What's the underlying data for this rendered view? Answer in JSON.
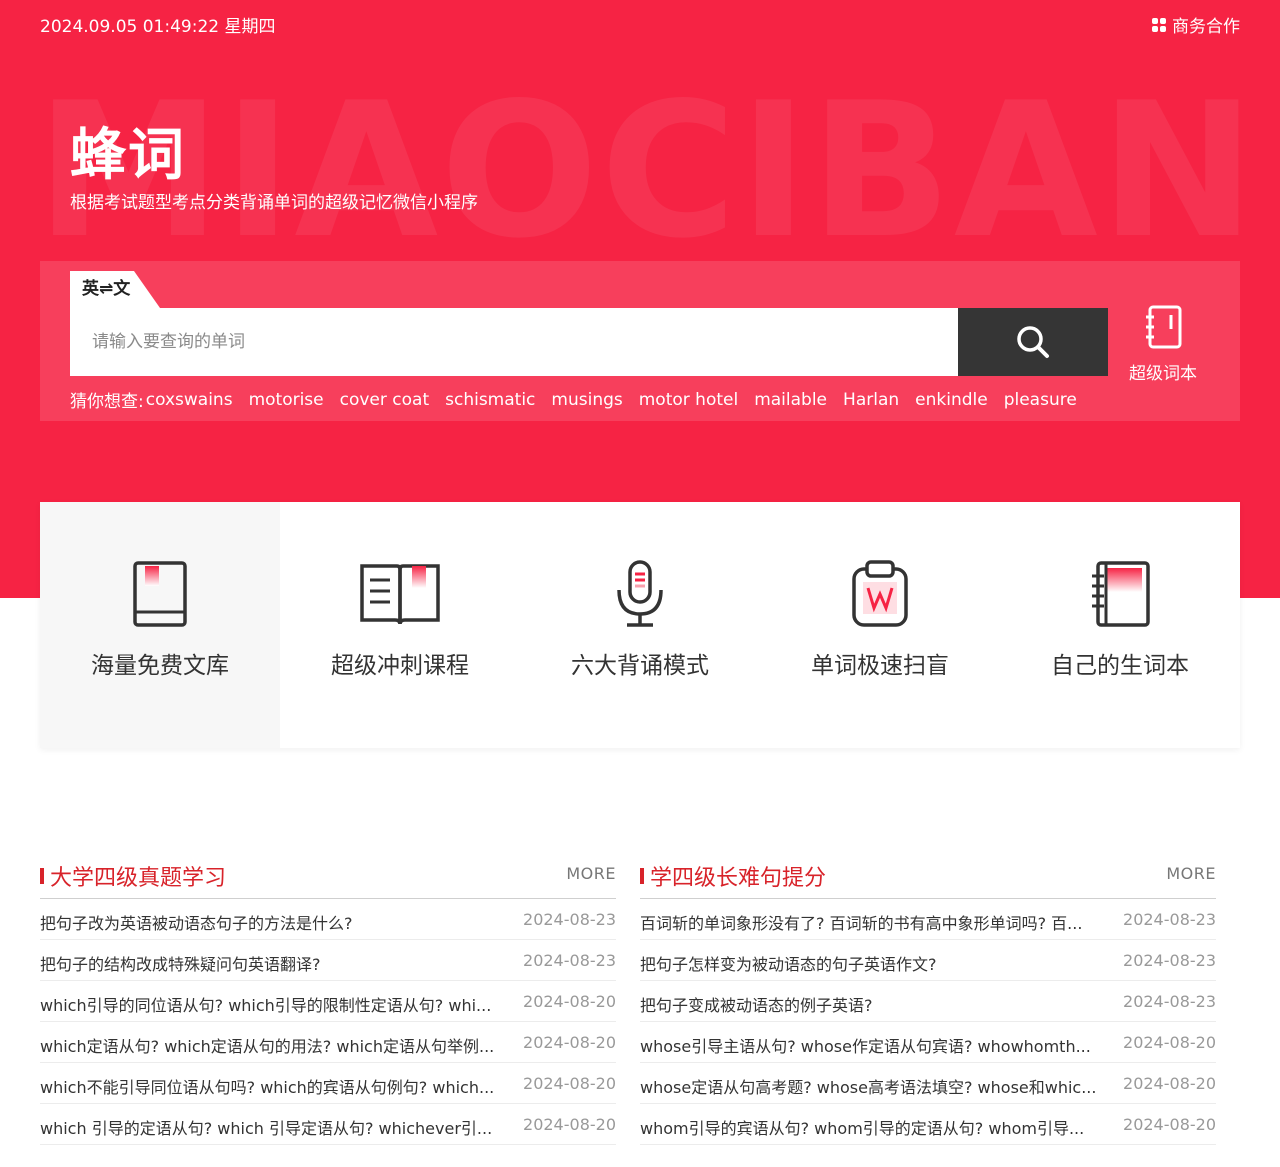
{
  "topbar": {
    "datetime": "2024.09.05 01:49:22 星期四",
    "business_label": "商务合作"
  },
  "hero": {
    "watermark": "MIAOCIBANG",
    "brand": "蜂词",
    "slogan": "根据考试题型考点分类背诵单词的超级记忆微信小程序"
  },
  "search": {
    "lang_toggle": "英⇌文",
    "placeholder": "请输入要查询的单词",
    "button_icon": "search-icon",
    "vocab_label": "超级词本",
    "guess_label": "猜你想查:",
    "suggestions": [
      "coxswains",
      "motorise",
      "cover coat",
      "schismatic",
      "musings",
      "motor hotel",
      "mailable",
      "Harlan",
      "enkindle",
      "pleasure"
    ]
  },
  "features": [
    {
      "label": "海量免费文库",
      "icon": "book-icon"
    },
    {
      "label": "超级冲刺课程",
      "icon": "open-book-icon"
    },
    {
      "label": "六大背诵模式",
      "icon": "microphone-icon"
    },
    {
      "label": "单词极速扫盲",
      "icon": "word-clipboard-icon"
    },
    {
      "label": "自己的生词本",
      "icon": "notebook-icon"
    }
  ],
  "colors": {
    "brand_red": "#f62344",
    "accent_red": "#d8232a",
    "dark_button": "#353535"
  },
  "news_left": {
    "title": "大学四级真题学习",
    "more": "MORE",
    "items": [
      {
        "title": "把句子改为英语被动语态句子的方法是什么?",
        "date": "2024-08-23"
      },
      {
        "title": "把句子的结构改成特殊疑问句英语翻译?",
        "date": "2024-08-23"
      },
      {
        "title": "which引导的同位语从句? which引导的限制性定语从句? whi...",
        "date": "2024-08-20"
      },
      {
        "title": "which定语从句? which定语从句的用法? which定语从句举例...",
        "date": "2024-08-20"
      },
      {
        "title": "which不能引导同位语从句吗? which的宾语从句例句? which...",
        "date": "2024-08-20"
      },
      {
        "title": "which 引导的定语从句? which 引导定语从句? whichever引...",
        "date": "2024-08-20"
      }
    ]
  },
  "news_right": {
    "title": "学四级长难句提分",
    "more": "MORE",
    "items": [
      {
        "title": "百词斩的单词象形没有了? 百词斩的书有高中象形单词吗? 百...",
        "date": "2024-08-23"
      },
      {
        "title": "把句子怎样变为被动语态的句子英语作文?",
        "date": "2024-08-23"
      },
      {
        "title": "把句子变成被动语态的例子英语?",
        "date": "2024-08-23"
      },
      {
        "title": "whose引导主语从句? whose作定语从句宾语? whowhomth...",
        "date": "2024-08-20"
      },
      {
        "title": "whose定语从句高考题? whose高考语法填空? whose和whic...",
        "date": "2024-08-20"
      },
      {
        "title": "whom引导的宾语从句? whom引导的定语从句? whom引导...",
        "date": "2024-08-20"
      }
    ]
  }
}
